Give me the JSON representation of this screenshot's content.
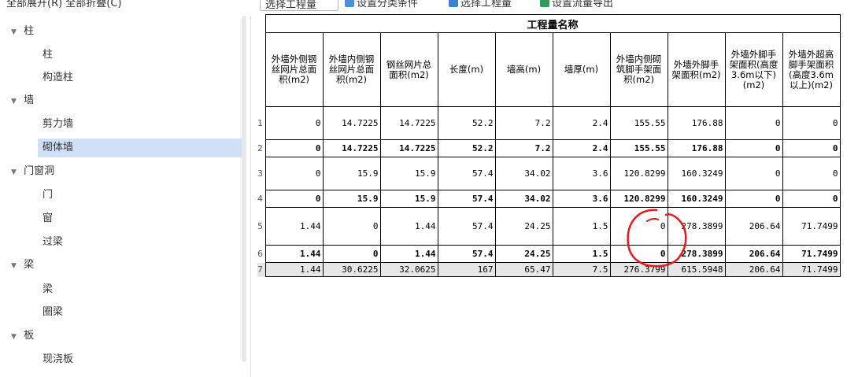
{
  "toolbar": {
    "left_text": "全部展开(R)    全部折叠(C)",
    "combo_value": "选择工程量",
    "btn_classify": "设置分类条件",
    "btn_select_qty": "选择工程量",
    "btn_export": "设置流量导出"
  },
  "tree": {
    "cats": [
      {
        "label": "柱",
        "items": [
          "柱",
          "构造柱"
        ]
      },
      {
        "label": "墙",
        "items": [
          "剪力墙",
          "砌体墙"
        ]
      },
      {
        "label": "门窗洞",
        "items": [
          "门",
          "窗",
          "过梁"
        ]
      },
      {
        "label": "梁",
        "items": [
          "梁",
          "圈梁"
        ]
      },
      {
        "label": "板",
        "items": [
          "现浇板"
        ]
      }
    ],
    "selected": "砌体墙"
  },
  "table": {
    "group_title": "工程量名称",
    "headers": [
      "外墙外侧钢丝网片总面积(m2)",
      "外墙内侧钢丝网片总面积(m2)",
      "钢丝网片总面积(m2)",
      "长度(m)",
      "墙高(m)",
      "墙厚(m)",
      "外墙内侧砌筑脚手架面积(m2)",
      "外墙外脚手架面积(m2)",
      "外墙外脚手架面积(高度3.6m以下)(m2)",
      "外墙外超高脚手架面积(高度3.6m以上)(m2)"
    ],
    "rows": [
      {
        "n": "1",
        "style": "normal",
        "cells": [
          "0",
          "14.7225",
          "14.7225",
          "52.2",
          "7.2",
          "2.4",
          "155.55",
          "176.88",
          "0",
          "0"
        ]
      },
      {
        "n": "2",
        "style": "bold",
        "cells": [
          "0",
          "14.7225",
          "14.7225",
          "52.2",
          "7.2",
          "2.4",
          "155.55",
          "176.88",
          "0",
          "0"
        ]
      },
      {
        "n": "3",
        "style": "normal",
        "cells": [
          "0",
          "15.9",
          "15.9",
          "57.4",
          "34.02",
          "3.6",
          "120.8299",
          "160.3249",
          "0",
          "0"
        ]
      },
      {
        "n": "4",
        "style": "bold",
        "cells": [
          "0",
          "15.9",
          "15.9",
          "57.4",
          "34.02",
          "3.6",
          "120.8299",
          "160.3249",
          "0",
          "0"
        ]
      },
      {
        "n": "5",
        "style": "normal",
        "cells": [
          "1.44",
          "0",
          "1.44",
          "57.4",
          "24.25",
          "1.5",
          "0",
          "278.3899",
          "206.64",
          "71.7499"
        ]
      },
      {
        "n": "6",
        "style": "bold",
        "cells": [
          "1.44",
          "0",
          "1.44",
          "57.4",
          "24.25",
          "1.5",
          "0",
          "278.3899",
          "206.64",
          "71.7499"
        ]
      },
      {
        "n": "7",
        "style": "total",
        "cells": [
          "1.44",
          "30.6225",
          "32.0625",
          "167",
          "65.47",
          "7.5",
          "276.3799",
          "615.5948",
          "206.64",
          "71.7499"
        ]
      }
    ]
  },
  "colors": {
    "selected_bg": "#cfe0f7",
    "total_row_bg": "#e6e6e6",
    "annotation": "#e8191b"
  }
}
